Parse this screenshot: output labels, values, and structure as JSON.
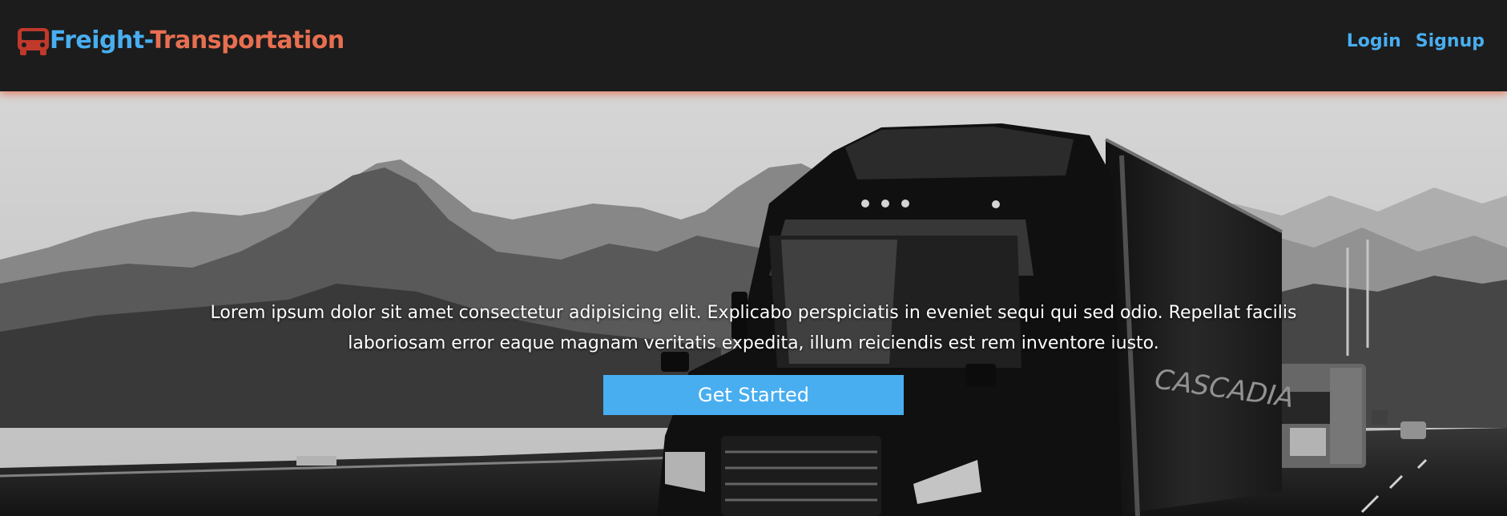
{
  "navbar": {
    "logo_icon": "truck-icon",
    "brand_part1": "Freight-",
    "brand_part2": "Transportation",
    "links": [
      {
        "label": "Login"
      },
      {
        "label": "Signup"
      }
    ]
  },
  "hero": {
    "text": "Lorem ipsum dolor sit amet consectetur adipisicing elit. Explicabo perspiciatis in eveniet sequi qui sed odio. Repellat facilis laboriosam error eaque magnam veritatis expedita, illum reiciendis est rem inventore iusto.",
    "cta_label": "Get Started",
    "background": "grayscale photo of a black semi truck with trailer driving on a desert highway with mountains"
  },
  "colors": {
    "navbar_bg": "#1c1c1c",
    "brand_blue": "#48aef0",
    "brand_orange": "#e76f51",
    "truck_icon": "#c0392b",
    "cta_bg": "#48aef0"
  }
}
